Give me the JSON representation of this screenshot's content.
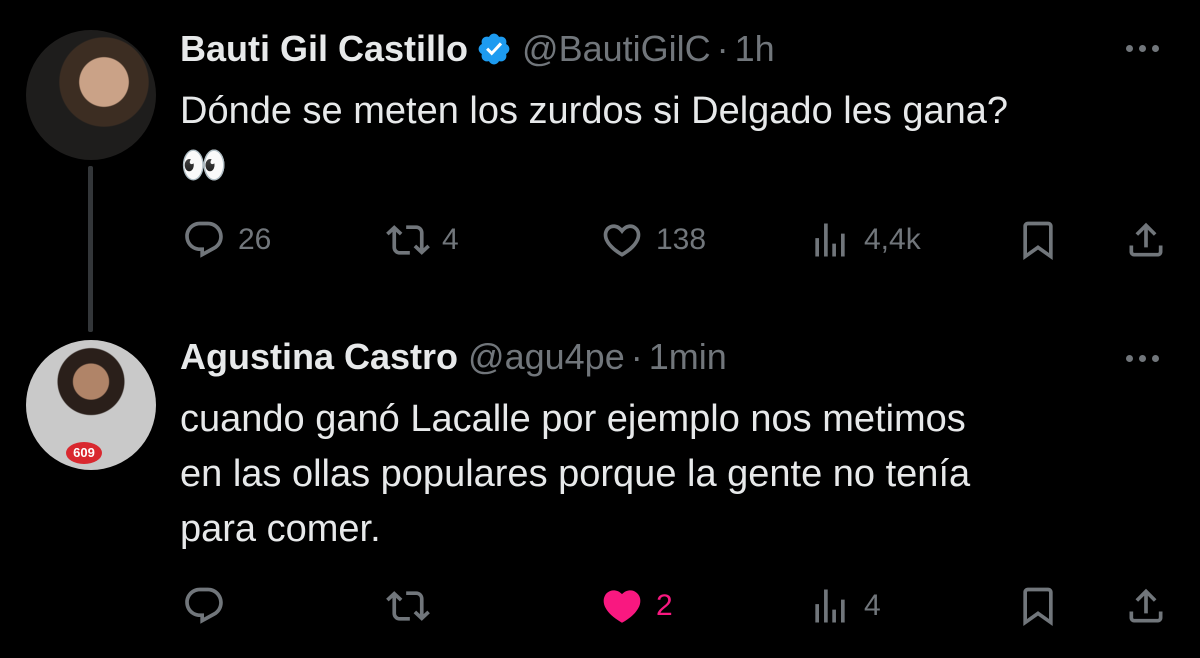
{
  "tweets": [
    {
      "name": "Bauti Gil Castillo",
      "handle": "@BautiGilC",
      "separator": "·",
      "time": "1h",
      "text_line1": "Dónde se meten los zurdos si Delgado les gana?",
      "text_line2": "👀",
      "replies": "26",
      "retweets": "4",
      "likes": "138",
      "views": "4,4k",
      "liked": false
    },
    {
      "name": "Agustina Castro",
      "handle": "@agu4pe",
      "separator": "·",
      "time": "1min",
      "text_line1": "cuando ganó Lacalle por ejemplo nos metimos",
      "text_line2": "en las ollas populares porque la gente no tenía",
      "text_line3": "para comer.",
      "avatar_badge": "609",
      "replies": "",
      "retweets": "",
      "likes": "2",
      "views": "4",
      "liked": true
    }
  ],
  "colors": {
    "background": "#000000",
    "text": "#e7e9ea",
    "muted": "#71767b",
    "verified": "#1d9bf0",
    "like": "#f91880"
  },
  "icons": [
    "reply-icon",
    "retweet-icon",
    "heart-icon",
    "views-icon",
    "bookmark-icon",
    "share-icon",
    "verified-icon",
    "more-icon"
  ]
}
